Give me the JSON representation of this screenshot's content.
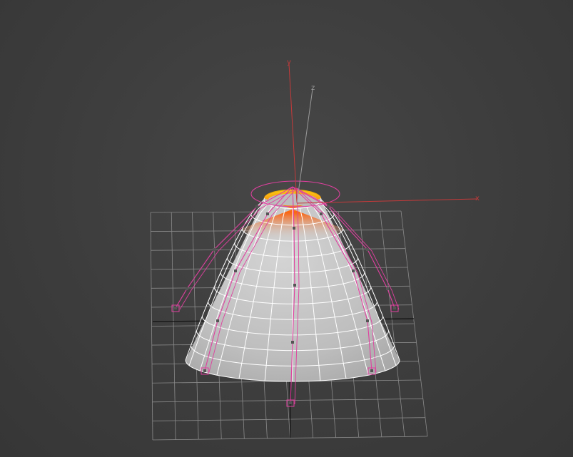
{
  "viewport": {
    "name": "perspective-viewport",
    "background": "#3f3f3f"
  },
  "gizmo": {
    "x_label": "x",
    "y_label": "y",
    "z_label": "z",
    "x_color": "#c43a3a",
    "y_color": "#c43a3a",
    "z_color": "#9a9a9a"
  },
  "grid": {
    "color": "#8a8a8a",
    "axis_color": "#111111"
  },
  "mesh": {
    "type": "cone-dome",
    "face_color": "#c8c8c8",
    "wire_color": "#ffffff",
    "soft_selection_colors": [
      "#ff2a00",
      "#ff7a00",
      "#ffd000"
    ]
  },
  "cage": {
    "color": "#e040a0",
    "vertex_color": "#555555"
  }
}
